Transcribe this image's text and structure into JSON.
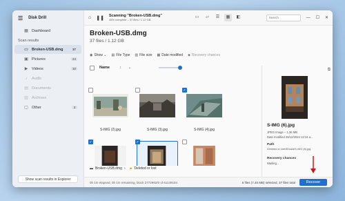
{
  "sidebar": {
    "app_name": "Disk Drill",
    "dashboard": "Dashboard",
    "section": "Scan results",
    "items": [
      {
        "label": "Broken-USB.dmg",
        "count": "37",
        "icon": "drive-icon"
      },
      {
        "label": "Pictures",
        "count": "24",
        "icon": "pictures-icon"
      },
      {
        "label": "Videos",
        "count": "10",
        "icon": "videos-icon"
      },
      {
        "label": "Audio",
        "count": "",
        "icon": "audio-icon"
      },
      {
        "label": "Documents",
        "count": "",
        "icon": "documents-icon"
      },
      {
        "label": "Archives",
        "count": "",
        "icon": "archives-icon"
      },
      {
        "label": "Other",
        "count": "3",
        "icon": "other-icon"
      }
    ],
    "footer_button": "Show scan results in Explorer"
  },
  "topbar": {
    "scan_title": "Scanning \"Broken-USB.dmg\"",
    "scan_progress": "45% complete – 37 files / 1.12 GB",
    "search_placeholder": "Search"
  },
  "header": {
    "title": "Broken-USB.dmg",
    "subtitle": "37 files / 1.12 GB"
  },
  "filters": {
    "show": "Show",
    "file_type": "File Type",
    "file_size": "File size",
    "date_modified": "Date modified",
    "recovery_chances": "Recovery chances"
  },
  "list": {
    "name_header": "Name",
    "sort_indicator": "↕"
  },
  "tiles": [
    {
      "caption": "S-IMG (2).jpg",
      "checked": false
    },
    {
      "caption": "S-IMG (3).jpg",
      "checked": false
    },
    {
      "caption": "S-IMG (4).jpg",
      "checked": true
    },
    {
      "caption": "",
      "checked": true
    },
    {
      "caption": "",
      "checked": true
    },
    {
      "caption": "",
      "checked": false
    }
  ],
  "breadcrumb": {
    "root": "Broken-USB.dmg",
    "folder": "Deleted or lost"
  },
  "preview": {
    "name": "S-IMG (6).jpg",
    "type_size": "JPEG Image – 1.36 MB",
    "date": "Date modified 28/12/2024 12:24 a...",
    "path_label": "Path",
    "path_value": "\\Deleted or lost\\SDcard\\S-IMG (6).jpg",
    "chances_label": "Recovery chances",
    "chances_value": "Waiting..."
  },
  "statusbar": {
    "left": "0h 1m elapsed, 0h 1m remaining, block 2772992/0 of 61149184",
    "right": "6 files (7.45 MB) selected, 37 files total",
    "recover": "Recover"
  },
  "colors": {
    "accent": "#1f6fd1",
    "arrow": "#c61a1a"
  }
}
